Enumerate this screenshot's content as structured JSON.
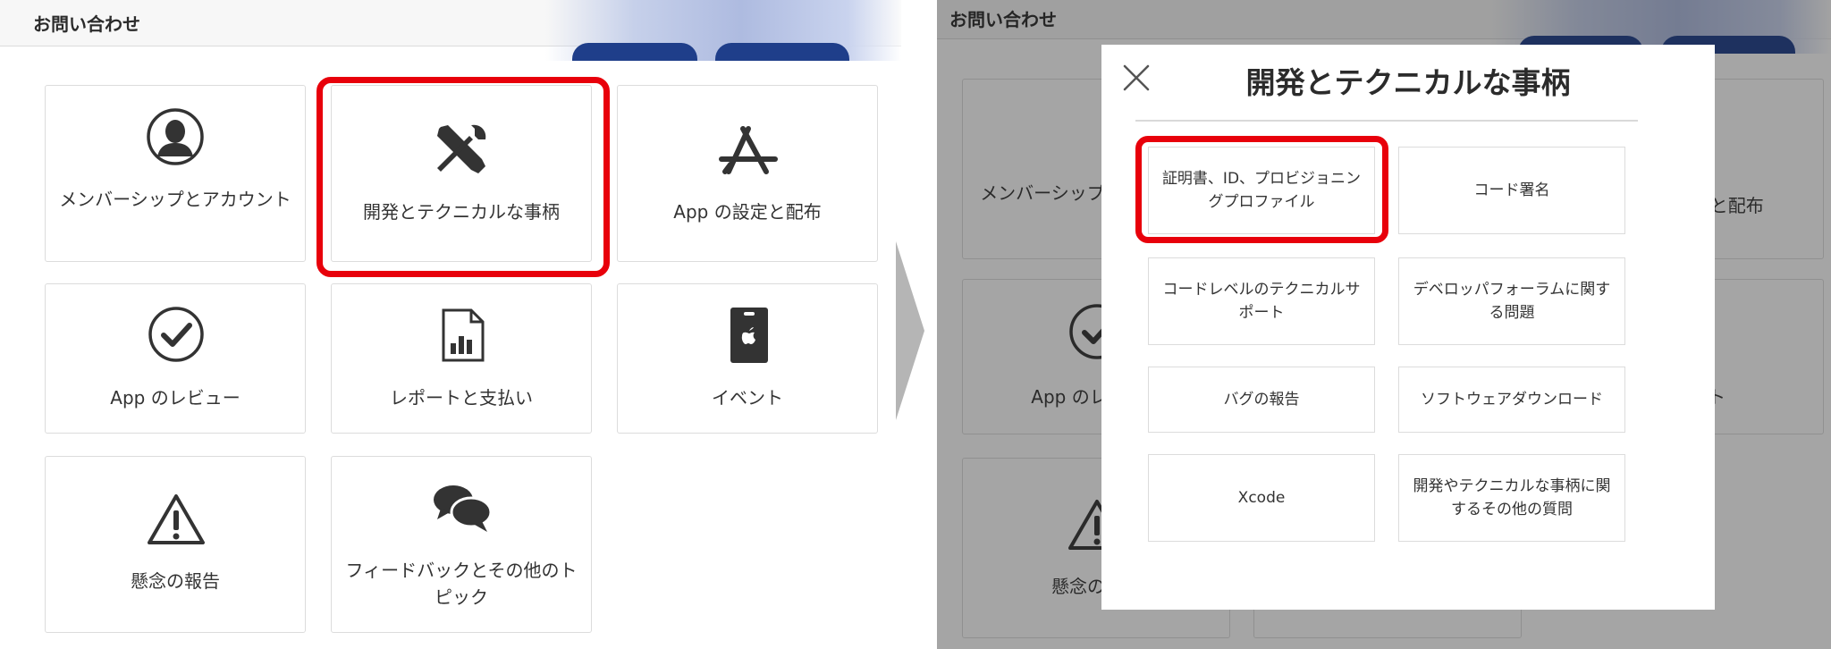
{
  "header": {
    "title": "お問い合わせ"
  },
  "cards": [
    {
      "label": "メンバーシップとアカウント",
      "icon": "person-icon"
    },
    {
      "label": "開発とテクニカルな事柄",
      "icon": "tools-icon"
    },
    {
      "label": "App の設定と配布",
      "icon": "app-store-icon"
    },
    {
      "label": "App のレビュー",
      "icon": "checkmark-icon"
    },
    {
      "label": "レポートと支払い",
      "icon": "report-icon"
    },
    {
      "label": "イベント",
      "icon": "event-badge-icon"
    },
    {
      "label": "懸念の報告",
      "icon": "warning-icon"
    },
    {
      "label": "フィードバックとその他のトピック",
      "icon": "speech-bubbles-icon"
    }
  ],
  "modal": {
    "title": "開発とテクニカルな事柄",
    "options": [
      {
        "label": "証明書、ID、プロビジョニングプロファイル"
      },
      {
        "label": "コード署名"
      },
      {
        "label": "コードレベルのテクニカルサポート"
      },
      {
        "label": "デベロッパフォーラムに関する問題"
      },
      {
        "label": "バグの報告"
      },
      {
        "label": "ソフトウェアダウンロード"
      },
      {
        "label": "Xcode"
      },
      {
        "label": "開発やテクニカルな事柄に関するその他の質問"
      }
    ]
  },
  "colors": {
    "highlight": "#e8000b",
    "icon": "#333333",
    "card_border": "#dcdcdc"
  }
}
